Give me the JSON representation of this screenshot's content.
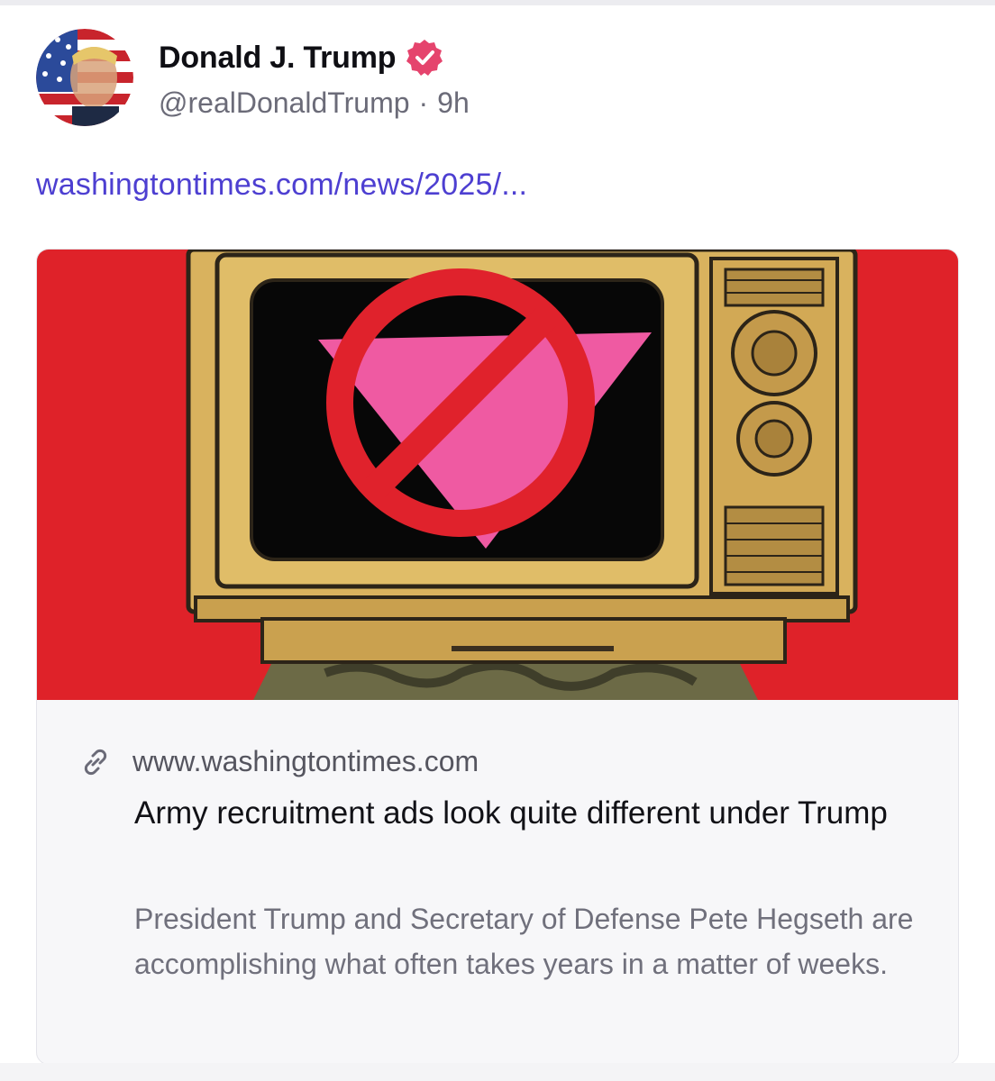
{
  "post": {
    "author": {
      "display_name": "Donald J. Trump",
      "handle": "@realDonaldTrump",
      "separator": "·",
      "time": "9h",
      "verified_icon": "verified-badge-icon",
      "avatar": "avatar-image"
    },
    "link_text": "washingtontimes.com/news/2025/...",
    "link_preview": {
      "icon": "link-icon",
      "domain": "www.washingtontimes.com",
      "title": "Army recruitment ads look quite different under Trump",
      "description": "President Trump and Secretary of Defense Pete Hegseth are accomplishing what often takes years in a matter of weeks."
    }
  },
  "colors": {
    "link": "#4d3fd1",
    "verified": "#e5446d",
    "image_background": "#e5242b",
    "tv_body": "#d9b25e",
    "prohibition": "#e0222c",
    "triangle": "#ef5aa2"
  }
}
